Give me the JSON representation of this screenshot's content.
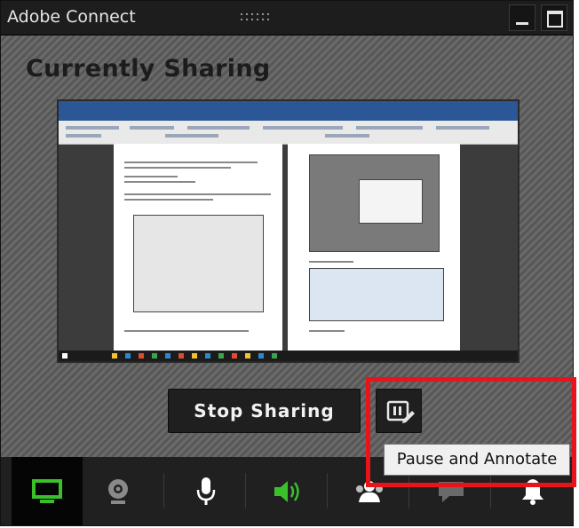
{
  "window": {
    "title": "Adobe Connect"
  },
  "content": {
    "heading": "Currently Sharing"
  },
  "actions": {
    "stop_label": "Stop Sharing"
  },
  "tooltip": {
    "text": "Pause and Annotate"
  },
  "toolbar": {
    "items": [
      {
        "icon": "share-screen-icon",
        "active": true,
        "color": "#3bbf2b"
      },
      {
        "icon": "webcam-icon",
        "active": false,
        "color": "#8a8a8a"
      },
      {
        "icon": "microphone-icon",
        "active": false,
        "color": "#ffffff"
      },
      {
        "icon": "speaker-icon",
        "active": false,
        "color": "#3bbf2b"
      },
      {
        "icon": "attendees-icon",
        "active": false,
        "color": "#ffffff"
      },
      {
        "icon": "chat-icon",
        "active": false,
        "color": "#6a6a6a"
      },
      {
        "icon": "notification-icon",
        "active": false,
        "color": "#ffffff"
      }
    ]
  },
  "colors": {
    "highlight": "#e8141a",
    "accent_green": "#3bbf2b"
  }
}
